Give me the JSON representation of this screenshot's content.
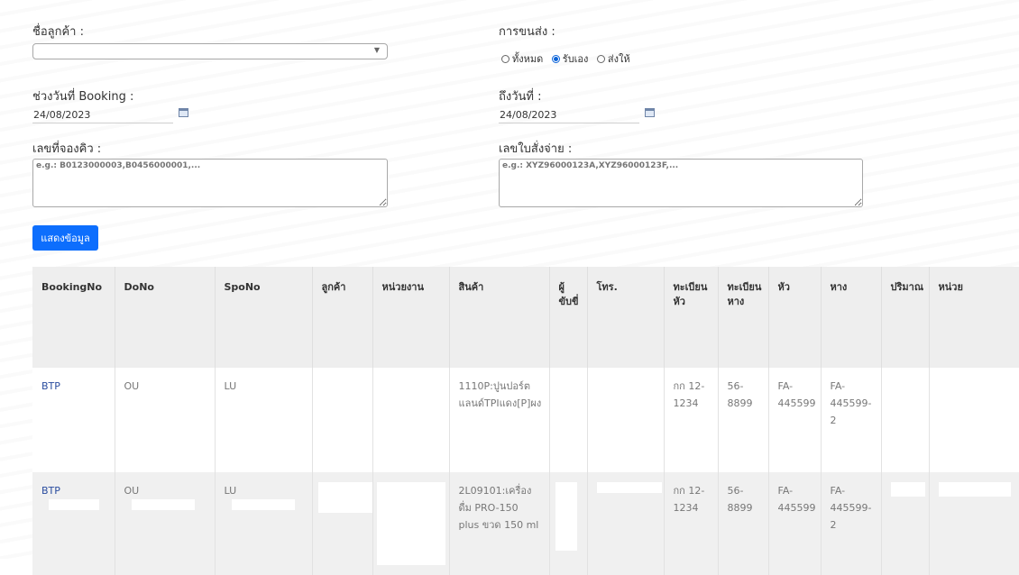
{
  "form": {
    "customer_label": "ชื่อลูกค้า :",
    "customer_value": "",
    "transport_label": "การขนส่ง :",
    "transport_options": [
      "ทั้งหมด",
      "รับเอง",
      "ส่งให้"
    ],
    "transport_selected": "รับเอง",
    "booking_from_label": "ช่วงวันที่ Booking :",
    "booking_from_value": "24/08/2023",
    "booking_to_label": "ถึงวันที่ :",
    "booking_to_value": "24/08/2023",
    "queue_label": "เลขที่จองคิว :",
    "queue_placeholder": "e.g.: B0123000003,B0456000001,...",
    "payment_label": "เลขใบสั่งจ่าย :",
    "payment_placeholder": "e.g.: XYZ96000123A,XYZ96000123F,...",
    "show_button": "แสดงข้อมูล"
  },
  "table": {
    "headers": [
      "BookingNo",
      "DoNo",
      "SpoNo",
      "ลูกค้า",
      "หน่วยงาน",
      "สินค้า",
      "ผู้ขับขี่",
      "โทร.",
      "ทะเบียนหัว",
      "ทะเบียนหาง",
      "หัว",
      "หาง",
      "ปริมาณ",
      "หน่วย"
    ],
    "rows": [
      [
        "BTP",
        "OU",
        "LU",
        "",
        "",
        "1110P:ปูนปอร์ตแลนด์TPIแดง[P]ผง",
        "",
        "",
        "กก 12-1234",
        "56-8899",
        "FA-445599",
        "FA-445599-2",
        "",
        ""
      ],
      [
        "BTP",
        "OU",
        "LU",
        "",
        "",
        "2L09101:เครื่องดื่ม PRO-150 plus ขวด 150 ml",
        "",
        "",
        "กก 12-1234",
        "56-8899",
        "FA-445599",
        "FA-445599-2",
        "",
        ""
      ]
    ]
  }
}
